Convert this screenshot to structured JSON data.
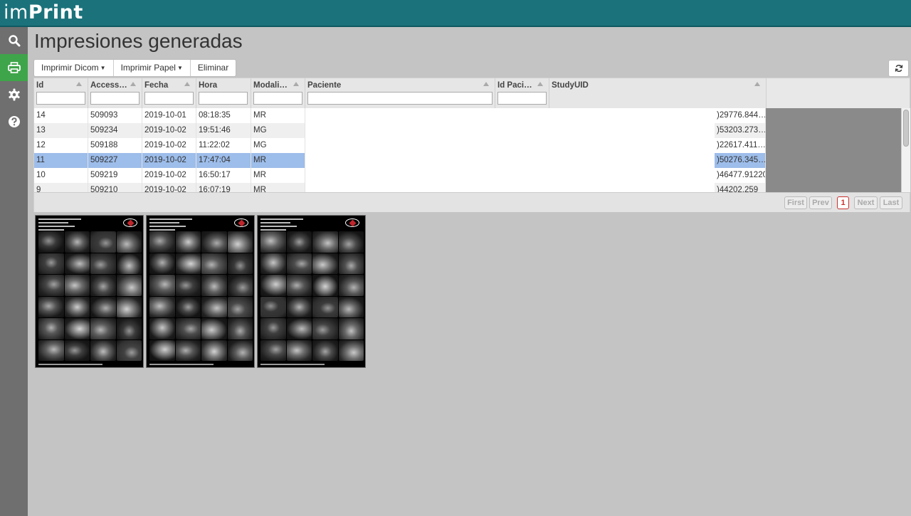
{
  "app": {
    "brand_light": "im",
    "brand_bold": "Print"
  },
  "colors": {
    "topbar": "#1b727b",
    "sidebar": "#6f6f6f",
    "sidebar_active": "#3fa54a",
    "row_selected": "#9dbdea",
    "row_alt": "#efefef",
    "page_current": "#c9302c"
  },
  "sidebar": {
    "items": [
      {
        "icon": "search-icon",
        "active": false
      },
      {
        "icon": "print-icon",
        "active": true
      },
      {
        "icon": "gear-icon",
        "active": false
      },
      {
        "icon": "question-icon",
        "active": false
      }
    ]
  },
  "page": {
    "title": "Impresiones generadas"
  },
  "toolbar": {
    "print_dicom_label": "Imprimir Dicom",
    "print_paper_label": "Imprimir Papel",
    "delete_label": "Eliminar",
    "refresh_icon": "refresh-icon"
  },
  "table": {
    "columns": [
      {
        "label": "Id",
        "filter": ""
      },
      {
        "label": "Access…",
        "filter": ""
      },
      {
        "label": "Fecha",
        "filter": ""
      },
      {
        "label": "Hora",
        "filter": ""
      },
      {
        "label": "Modali…",
        "filter": ""
      },
      {
        "label": "Paciente",
        "filter": ""
      },
      {
        "label": "Id Paci…",
        "filter": ""
      },
      {
        "label": "StudyUID",
        "filter": ""
      }
    ],
    "rows": [
      {
        "id": "14",
        "access": "509093",
        "fecha": "2019-10-01",
        "hora": "08:18:35",
        "modalidad": "MR",
        "uid": ")29776.844…",
        "selected": false
      },
      {
        "id": "13",
        "access": "509234",
        "fecha": "2019-10-02",
        "hora": "19:51:46",
        "modalidad": "MG",
        "uid": ")53203.273…",
        "selected": false
      },
      {
        "id": "12",
        "access": "509188",
        "fecha": "2019-10-02",
        "hora": "11:22:02",
        "modalidad": "MG",
        "uid": ")22617.411…",
        "selected": false
      },
      {
        "id": "11",
        "access": "509227",
        "fecha": "2019-10-02",
        "hora": "17:47:04",
        "modalidad": "MR",
        "uid": ")50276.345…",
        "selected": true
      },
      {
        "id": "10",
        "access": "509219",
        "fecha": "2019-10-02",
        "hora": "16:50:17",
        "modalidad": "MR",
        "uid": ")46477.91220",
        "selected": false
      },
      {
        "id": "9",
        "access": "509210",
        "fecha": "2019-10-02",
        "hora": "16:07:19",
        "modalidad": "MR",
        "uid": ")44202.259",
        "selected": false
      }
    ]
  },
  "pager": {
    "first": "First",
    "prev": "Prev",
    "current": "1",
    "next": "Next",
    "last": "Last"
  },
  "thumbnails": [
    {
      "name": "print-preview-1"
    },
    {
      "name": "print-preview-2"
    },
    {
      "name": "print-preview-3"
    }
  ]
}
